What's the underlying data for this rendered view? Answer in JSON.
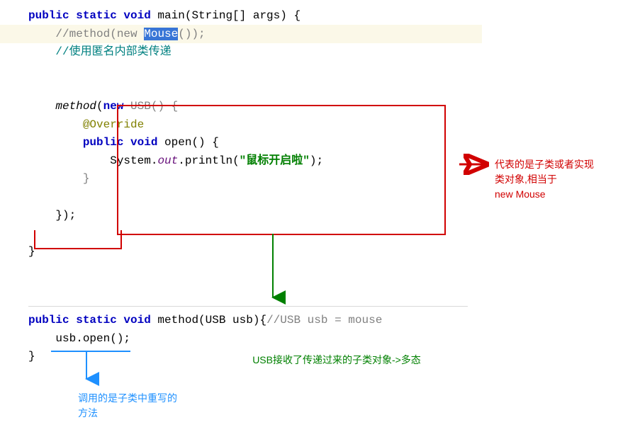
{
  "code": {
    "l1_kw1": "public static void",
    "l1_rest": " main(String[] args) {",
    "l2_pre": "//method(new ",
    "l2_sel": "Mouse",
    "l2_post": "());",
    "l3": "//使用匿名内部类传递",
    "m_italic": "method",
    "m_open": "(",
    "m_new": "new",
    "m_type": " USB() {",
    "m_annot": "@Override",
    "m_pv": "public void",
    "m_open_sig": " open() {",
    "m_sysout_a": "System.",
    "m_sysout_out": "out",
    "m_sysout_b": ".println(",
    "m_str": "\"鼠标开启啦\"",
    "m_sysout_end": ");",
    "m_close_inner": "}",
    "m_close_anon": "});",
    "close1": "}",
    "meth_kw": "public static void",
    "meth_sig": " method(USB usb){",
    "meth_comment": "//USB usb = mouse",
    "meth_body": "usb.open();",
    "meth_close": "}"
  },
  "an_red_1": "代表的是子类或者实现",
  "an_red_2": "类对象,相当于",
  "an_red_3": "new Mouse",
  "an_green": "USB接收了传递过来的子类对象->多态",
  "an_blue_1": "调用的是子类中重写的",
  "an_blue_2": "方法"
}
